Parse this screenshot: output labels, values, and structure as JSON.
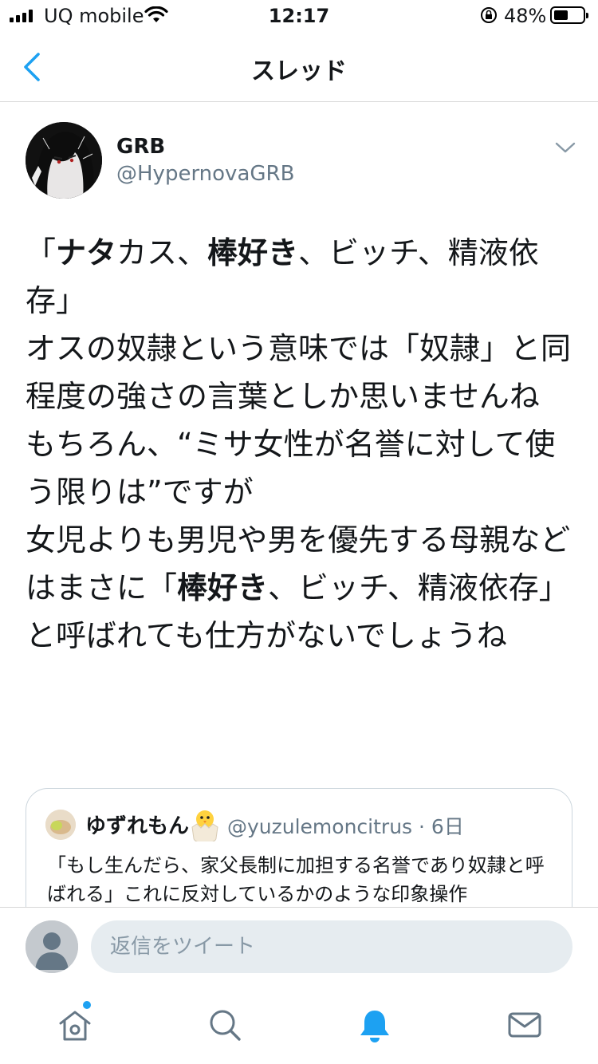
{
  "status_bar": {
    "carrier": "UQ mobile",
    "time": "12:17",
    "battery_percent": "48%",
    "battery_level": 0.48
  },
  "nav": {
    "title": "スレッド",
    "back_icon": "chevron-left-icon"
  },
  "tweet": {
    "display_name": "GRB",
    "handle": "@HypernovaGRB",
    "lines": {
      "l1_open": "「",
      "l1_b1": "ナタ",
      "l1_t1": "カス、",
      "l1_b2": "棒好き",
      "l1_t2": "、ビッチ、精液依存」",
      "l2": "オスの奴隷という意味では「奴隷」と同程度の強さの言葉としか思いませんね",
      "l3": "もちろん、“ミサ女性が名誉に対して使う限りは”ですが",
      "l4_t1": "女児よりも男児や男を優先する母親などはまさに「",
      "l4_b1": "棒好き",
      "l4_t2": "、ビッチ、精液依存」と呼ばれても仕方がないでしょうね"
    }
  },
  "quote": {
    "display_name": "ゆずれもん",
    "handle_time": "@yuzulemoncitrus · 6日",
    "text": "「もし生んだら、家父長制に加担する名誉であり奴隷と呼ばれる」これに反対しているかのような印象操作"
  },
  "reply": {
    "placeholder": "返信をツイート"
  },
  "tabs": [
    "home-icon",
    "search-icon",
    "notifications-icon",
    "messages-icon"
  ],
  "colors": {
    "accent": "#1da1f2",
    "secondary_text": "#657786",
    "primary_text": "#14171a"
  }
}
